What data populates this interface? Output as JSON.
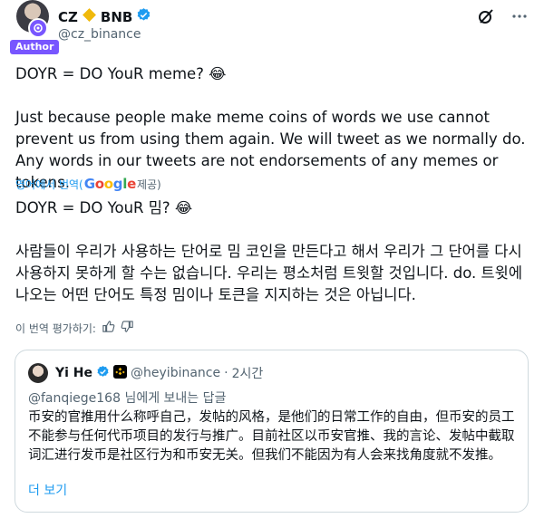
{
  "author": {
    "name": "CZ",
    "handle": "@cz_binance",
    "tag": "Author"
  },
  "tweet": {
    "original": [
      "DOYR = DO YouR meme? 😂",
      "Just because people make meme coins of words we use cannot prevent us from using them again. We will tweet as we normally do. Any words in our tweets are not endorsements of any memes or tokens."
    ],
    "translate_prefix": "영어에서 번역(",
    "translate_brand": "Google",
    "translate_suffix": " 제공)",
    "translated": [
      "DOYR = DO YouR 밈? 😂",
      "사람들이 우리가 사용하는 단어로 밈 코인을 만든다고 해서 우리가 그 단어를 다시 사용하지 못하게 할 수는 없습니다. 우리는 평소처럼 트윗할 것입니다. do. 트윗에 나오는 어떤 단어도 특정 밈이나 토큰을 지지하는 것은 아닙니다."
    ],
    "rate_label": "이 번역 평가하기:"
  },
  "quote": {
    "name": "Yi He",
    "handle": "@heyibinance",
    "separator": "·",
    "time": "2시간",
    "reply_to": "@fanqiege168 님에게 보내는 답글",
    "body": "币安的官推用什么称呼自己，发帖的风格，是他们的日常工作的自由，但币安的员工不能参与任何代币项目的发行与推广。目前社区以币安官推、我的言论、发帖中截取词汇进行发币是社区行为和币安无关。但我们不能因为有人会来找角度就不发推。",
    "more_label": "더 보기"
  },
  "icons": {
    "verified": "verified-badge-icon",
    "bnb_diamond": "bnb-diamond-icon",
    "grok": "grok-icon",
    "more": "more-dots-icon",
    "thumbs_up": "thumbs-up-icon",
    "thumbs_down": "thumbs-down-icon"
  },
  "colors": {
    "accent": "#1d9bf0",
    "author_tag": "#7856ff",
    "bnb": "#f0b90b",
    "muted": "#536471",
    "border": "#cfd9de"
  }
}
